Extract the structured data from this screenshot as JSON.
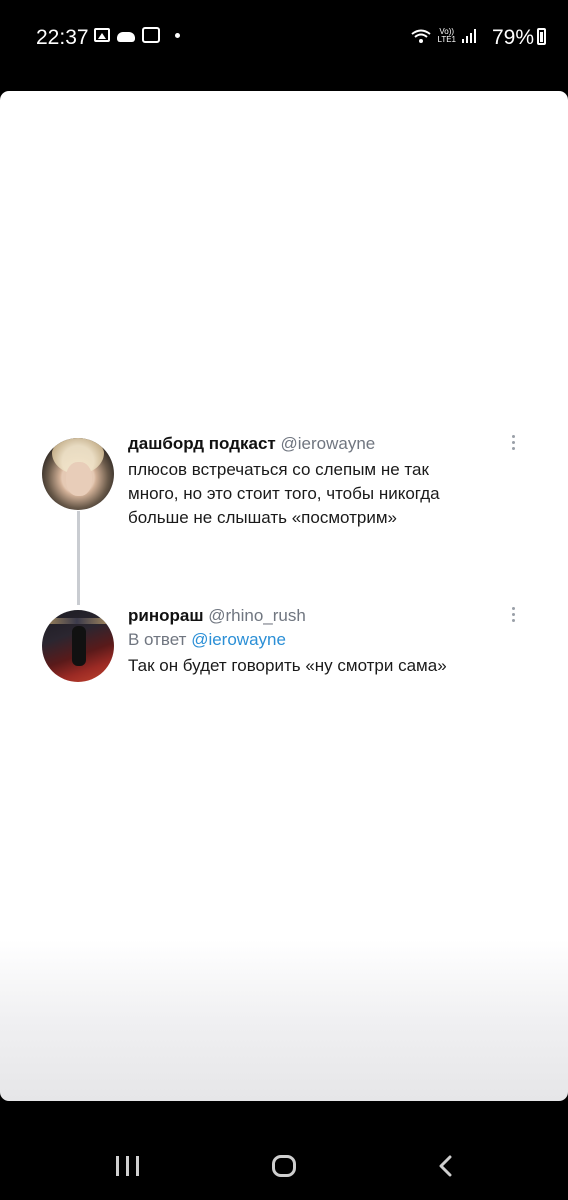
{
  "status_bar": {
    "time": "22:37",
    "network": "Vo))\nLTE1",
    "battery": "79%"
  },
  "tweets": [
    {
      "name": "дашборд подкаст",
      "handle": "@ierowayne",
      "text": "плюсов встречаться со слепым не так\nмного, но это стоит того, чтобы никогда\nбольше не слышать «посмотрим»"
    },
    {
      "name": "ринораш",
      "handle": "@rhino_rush",
      "reply_prefix": "В ответ",
      "reply_mention": "@ierowayne",
      "text": "Так он будет говорить «ну смотри сама»"
    }
  ],
  "navigation": [
    "recent-apps-icon",
    "home-icon",
    "back-icon"
  ],
  "colors": {
    "link": "#2b8fd6",
    "handle": "#707680",
    "thread_line": "#c9ccd1"
  }
}
